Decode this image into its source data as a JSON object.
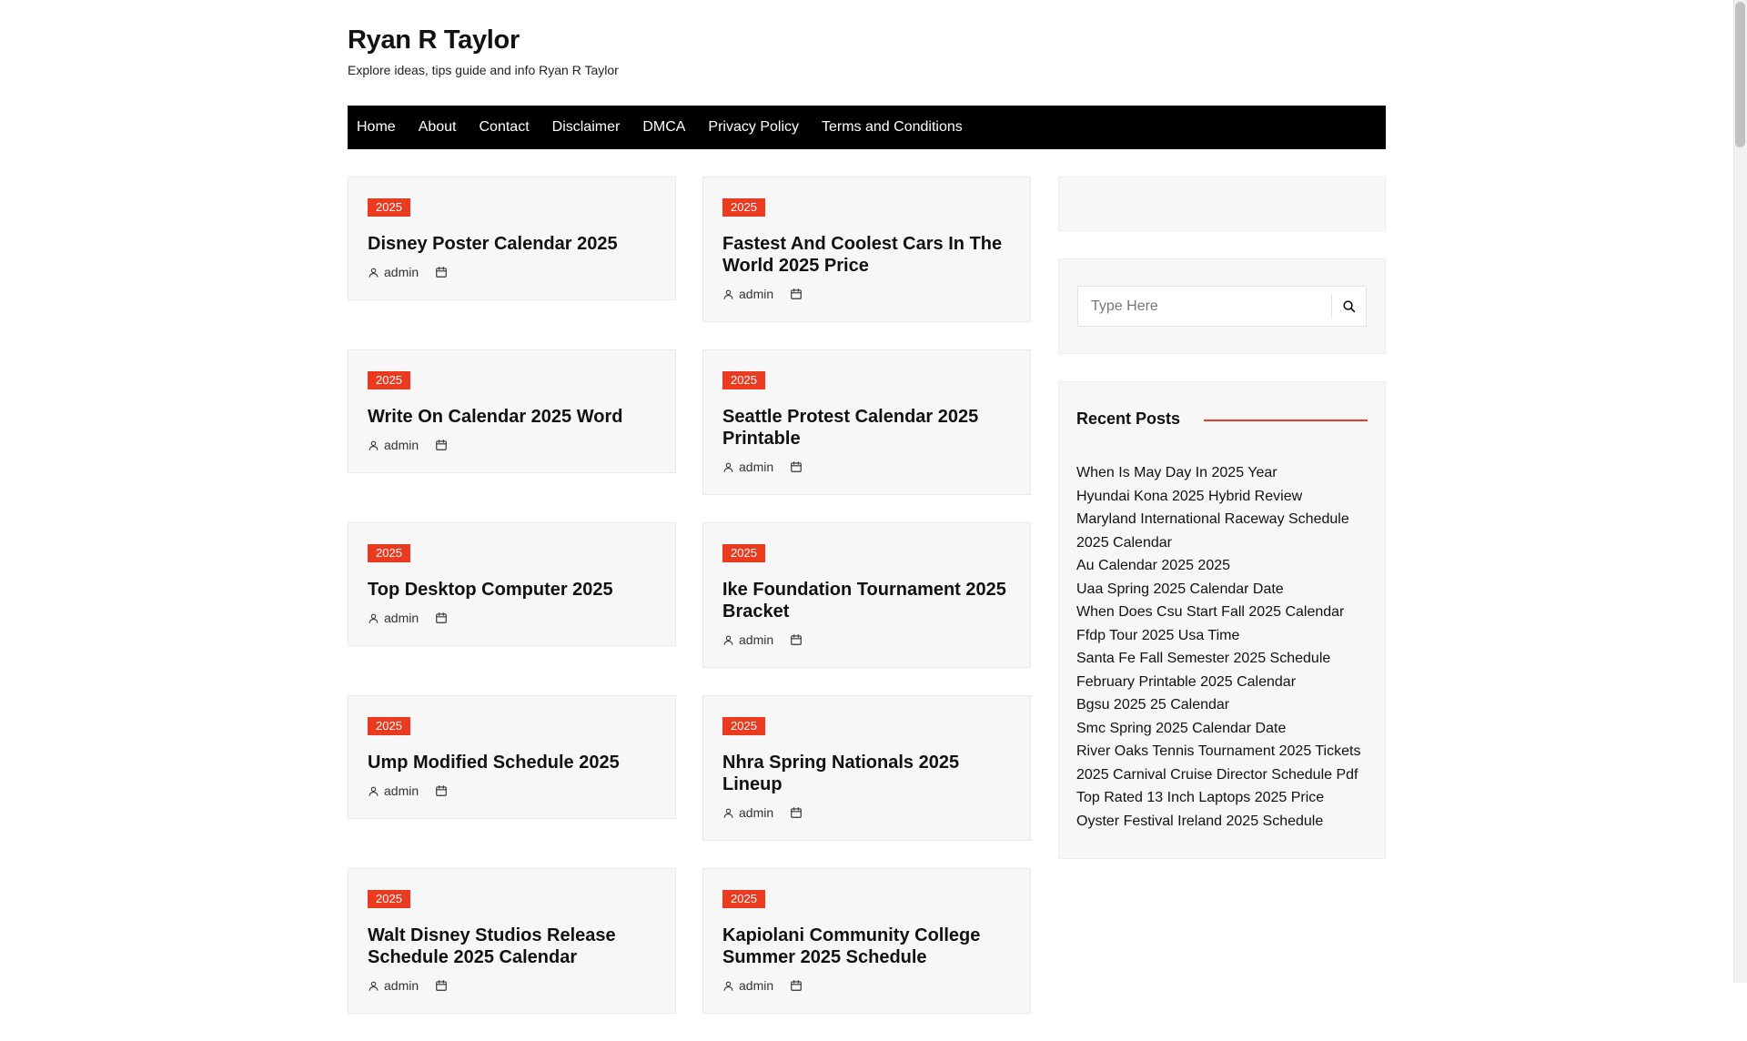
{
  "site": {
    "title": "Ryan R Taylor",
    "description": "Explore ideas, tips guide and info Ryan R Taylor"
  },
  "nav": [
    "Home",
    "About",
    "Contact",
    "Disclaimer",
    "DMCA",
    "Privacy Policy",
    "Terms and Conditions"
  ],
  "posts": [
    {
      "category": "2025",
      "title": "Disney Poster Calendar 2025",
      "author": "admin"
    },
    {
      "category": "2025",
      "title": "Fastest And Coolest Cars In The World 2025 Price",
      "author": "admin"
    },
    {
      "category": "2025",
      "title": "Write On Calendar 2025 Word",
      "author": "admin"
    },
    {
      "category": "2025",
      "title": "Seattle Protest Calendar 2025 Printable",
      "author": "admin"
    },
    {
      "category": "2025",
      "title": "Top Desktop Computer 2025",
      "author": "admin"
    },
    {
      "category": "2025",
      "title": "Ike Foundation Tournament 2025 Bracket",
      "author": "admin"
    },
    {
      "category": "2025",
      "title": "Ump Modified Schedule 2025",
      "author": "admin"
    },
    {
      "category": "2025",
      "title": "Nhra Spring Nationals 2025 Lineup",
      "author": "admin"
    },
    {
      "category": "2025",
      "title": "Walt Disney Studios Release Schedule 2025 Calendar",
      "author": "admin"
    },
    {
      "category": "2025",
      "title": "Kapiolani Community College Summer 2025 Schedule",
      "author": "admin"
    }
  ],
  "search": {
    "placeholder": "Type Here"
  },
  "recent": {
    "heading": "Recent Posts",
    "items": [
      "When Is May Day In 2025 Year",
      "Hyundai Kona 2025 Hybrid Review",
      "Maryland International Raceway Schedule 2025 Calendar",
      "Au Calendar 2025 2025",
      "Uaa Spring 2025 Calendar Date",
      "When Does Csu Start Fall 2025 Calendar",
      "Ffdp Tour 2025 Usa Time",
      "Santa Fe Fall Semester 2025 Schedule",
      "February Printable 2025 Calendar",
      "Bgsu 2025 25 Calendar",
      "Smc Spring 2025 Calendar Date",
      "River Oaks Tennis Tournament 2025 Tickets",
      "2025 Carnival Cruise Director Schedule Pdf",
      "Top Rated 13 Inch Laptops 2025 Price",
      "Oyster Festival Ireland 2025 Schedule"
    ]
  },
  "colors": {
    "accent": "#ea3a1f",
    "nav_bg": "#000000",
    "card_bg": "#f7f7f7"
  },
  "icons": {
    "author": "user-icon",
    "date": "calendar-icon",
    "search": "search-icon"
  }
}
